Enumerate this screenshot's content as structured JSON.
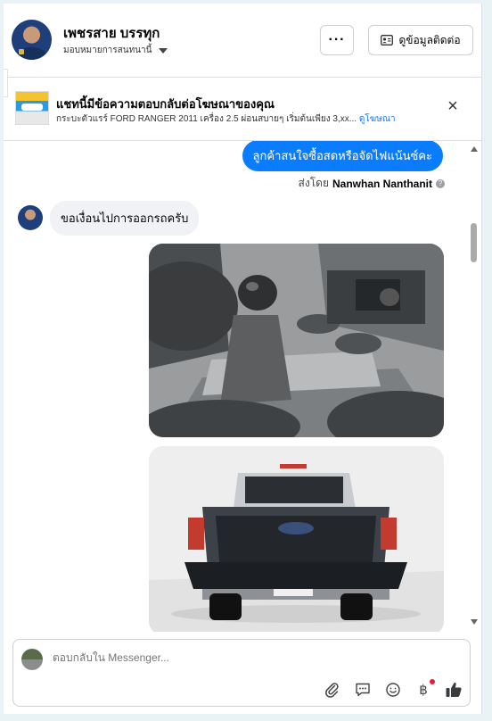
{
  "header": {
    "name": "เพชรสาย บรรทุก",
    "subtitle": "มอบหมายการสนทนานี้",
    "more_label": "···",
    "contact_label": "ดูข้อมูลติดต่อ"
  },
  "ad": {
    "title": "แชทนี้มีข้อความตอบกลับต่อโฆษณาของคุณ",
    "subtitle": "กระบะตัวแรร์ FORD RANGER 2011 เครื่อง 2.5 ผ่อนสบายๆ เริ่มต้นเพียง 3,xx...",
    "link": "ดูโฆษณา"
  },
  "messages": {
    "outgoing": "ลูกค้าสนใจซื้อสดหรือจัดไฟแน้นซ์คะ",
    "sent_by_prefix": "ส่งโดย",
    "sent_by_name": "Nanwhan Nanthanit",
    "incoming": "ขอเงื่อนไปการออกรถครับ"
  },
  "composer": {
    "placeholder": "ตอบกลับใน Messenger..."
  },
  "icons": {
    "attach": "paperclip-icon",
    "quick_reply": "chat-bubble-icon",
    "emoji": "smiley-icon",
    "payment": "baht-icon",
    "like": "thumbs-up-icon"
  },
  "colors": {
    "accent": "#0a7cff",
    "link": "#1877f2",
    "bubble_in": "#f0f2f5",
    "like_icon": "#3a3b3c",
    "notification": "#e41e3f"
  }
}
